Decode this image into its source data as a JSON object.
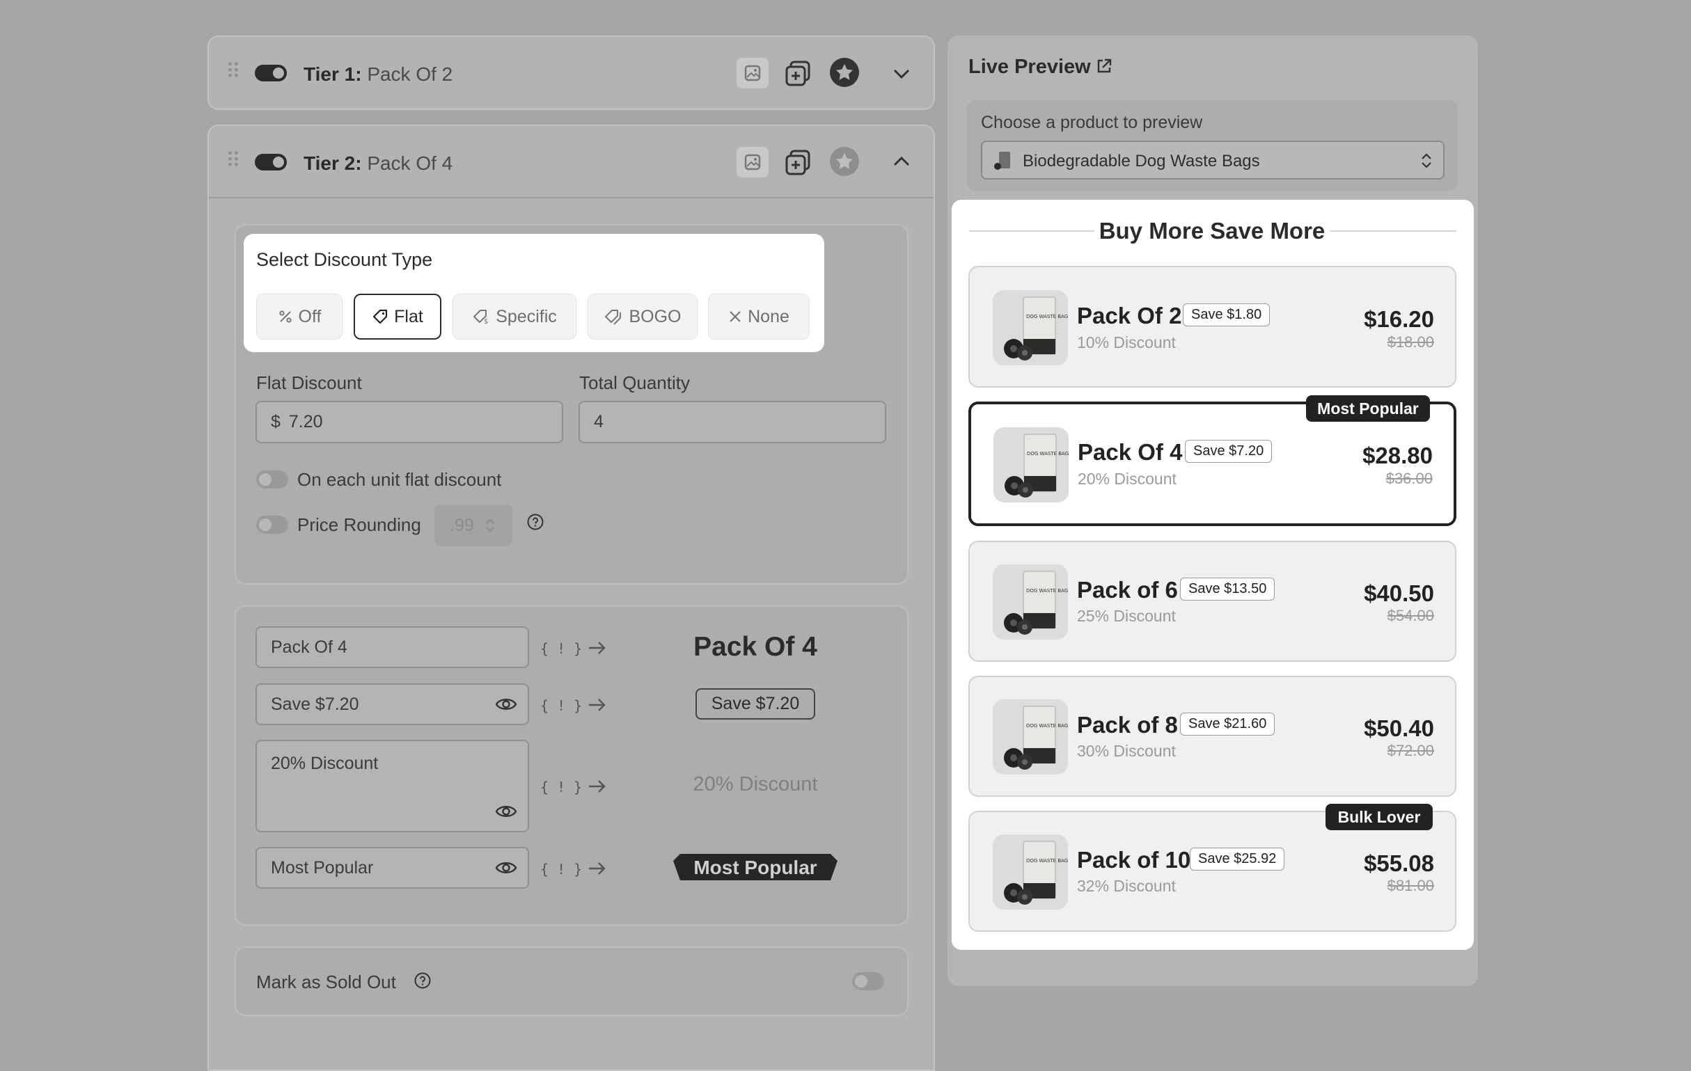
{
  "tiers": [
    {
      "label": "Tier 1:",
      "name": "Pack Of 2"
    },
    {
      "label": "Tier 2:",
      "name": "Pack Of 4"
    }
  ],
  "discount_type": {
    "title": "Select Discount Type",
    "options": [
      {
        "label": "Off",
        "icon": "percent-icon"
      },
      {
        "label": "Flat",
        "icon": "tag-icon"
      },
      {
        "label": "Specific",
        "icon": "price-tag-icon"
      },
      {
        "label": "BOGO",
        "icon": "double-tag-icon"
      },
      {
        "label": "None",
        "icon": "x-icon"
      }
    ],
    "selected": "Flat"
  },
  "flat_discount": {
    "label": "Flat Discount",
    "prefix": "$",
    "value": "7.20"
  },
  "total_quantity": {
    "label": "Total Quantity",
    "value": "4"
  },
  "each_unit": {
    "label": "On each unit flat discount"
  },
  "price_rounding": {
    "label": "Price Rounding",
    "value": ".99"
  },
  "text_fields": {
    "title": {
      "value": "Pack Of 4",
      "preview": "Pack Of 4"
    },
    "save": {
      "value": "Save $7.20",
      "preview": "Save $7.20"
    },
    "subtitle": {
      "value": "20% Discount",
      "preview": "20% Discount"
    },
    "badge": {
      "value": "Most Popular",
      "preview": "Most Popular"
    },
    "token": "{ ! }"
  },
  "sold_out": {
    "label": "Mark as Sold Out"
  },
  "preview": {
    "title": "Live Preview",
    "choose_label": "Choose a product to preview",
    "product": "Biodegradable Dog Waste Bags",
    "widget_title": "Buy More Save More",
    "rows": [
      {
        "title": "Pack Of 2",
        "save": "Save $1.80",
        "sub": "10% Discount",
        "price": "$16.20",
        "old": "$18.00",
        "badge": ""
      },
      {
        "title": "Pack Of 4",
        "save": "Save $7.20",
        "sub": "20% Discount",
        "price": "$28.80",
        "old": "$36.00",
        "badge": "Most Popular"
      },
      {
        "title": "Pack of 6",
        "save": "Save $13.50",
        "sub": "25% Discount",
        "price": "$40.50",
        "old": "$54.00",
        "badge": ""
      },
      {
        "title": "Pack of 8",
        "save": "Save $21.60",
        "sub": "30% Discount",
        "price": "$50.40",
        "old": "$72.00",
        "badge": ""
      },
      {
        "title": "Pack of 10",
        "save": "Save $25.92",
        "sub": "32% Discount",
        "price": "$55.08",
        "old": "$81.00",
        "badge": "Bulk Lover"
      }
    ]
  },
  "product_image_text": "DOG WASTE BAGS"
}
